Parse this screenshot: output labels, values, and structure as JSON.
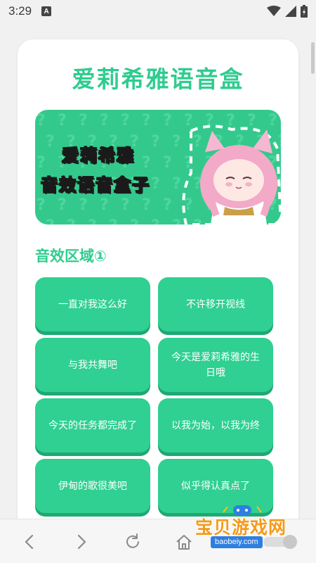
{
  "status_bar": {
    "time": "3:29",
    "notification_letter": "A"
  },
  "app": {
    "title": "爱莉希雅语音盒"
  },
  "banner": {
    "line1": "爱莉希雅",
    "line2": "音效语音盒子",
    "pattern_glyph": "?"
  },
  "section": {
    "title": "音效区域①"
  },
  "sounds": [
    {
      "label": "一直对我这么好"
    },
    {
      "label": "不许移开视线"
    },
    {
      "label": "与我共舞吧"
    },
    {
      "label": "今天是爱莉希雅的生日哦"
    },
    {
      "label": "今天的任务都完成了"
    },
    {
      "label": "以我为始，以我为终"
    },
    {
      "label": "伊甸的歌很美吧"
    },
    {
      "label": "似乎得认真点了"
    },
    {
      "label": ""
    },
    {
      "label": ""
    }
  ],
  "watermark": {
    "text": "宝贝游戏网",
    "url": "baobeiy.com"
  },
  "colors": {
    "accent": "#2fcc8f",
    "button": "#2fd091",
    "button_shadow": "#1fa873",
    "banner": "#34c98c"
  },
  "icons": [
    "wifi-icon",
    "signal-icon",
    "battery-icon",
    "back-icon",
    "forward-icon",
    "reload-icon",
    "home-icon"
  ]
}
